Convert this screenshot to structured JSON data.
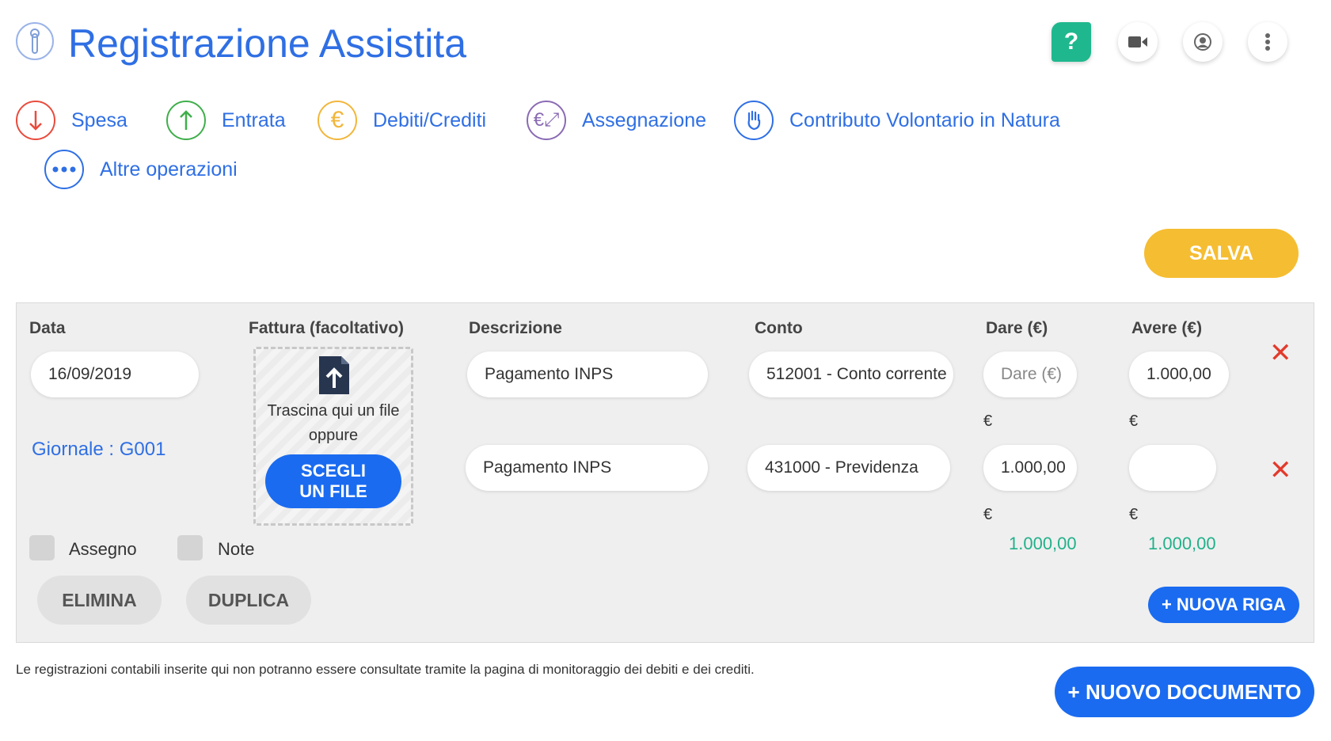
{
  "header": {
    "title": "Registrazione Assistita",
    "help_label": "?"
  },
  "operations": [
    {
      "label": "Spesa",
      "icon": "arrow-down-icon",
      "color": "#e94b3c"
    },
    {
      "label": "Entrata",
      "icon": "arrow-up-icon",
      "color": "#3fae4a"
    },
    {
      "label": "Debiti/Crediti",
      "icon": "euro-icon",
      "color": "#f2b63a"
    },
    {
      "label": "Assegnazione",
      "icon": "euro-exchange-icon",
      "color": "#8a6bb3"
    },
    {
      "label": "Contributo Volontario in Natura",
      "icon": "hand-icon",
      "color": "#2f6fe4"
    },
    {
      "label": "Altre operazioni",
      "icon": "more-horizontal-icon",
      "color": "#2f6fe4"
    }
  ],
  "save_label": "SALVA",
  "form": {
    "headers": {
      "data": "Data",
      "fattura": "Fattura (facoltativo)",
      "descrizione": "Descrizione",
      "conto": "Conto",
      "dare": "Dare (€)",
      "avere": "Avere (€)"
    },
    "date_value": "16/09/2019",
    "giornale_link": "Giornale : G001",
    "dropzone": {
      "line1": "Trascina qui un file",
      "line2": "oppure",
      "button_line1": "SCEGLI",
      "button_line2": "UN FILE"
    },
    "dare_placeholder": "Dare (€)",
    "rows": [
      {
        "descrizione": "Pagamento INPS",
        "conto": "512001 - Conto corrente",
        "dare": "",
        "avere": "1.000,00"
      },
      {
        "descrizione": "Pagamento INPS",
        "conto": "431000 - Previdenza",
        "dare": "1.000,00",
        "avere": ""
      }
    ],
    "currency_symbol": "€",
    "totals": {
      "dare": "1.000,00",
      "avere": "1.000,00"
    },
    "checkboxes": {
      "assegno": "Assegno",
      "note": "Note"
    },
    "buttons": {
      "elimina": "ELIMINA",
      "duplica": "DUPLICA",
      "nuova_riga": "+ NUOVA RIGA"
    }
  },
  "footnote": "Le registrazioni contabili inserite qui non potranno essere consultate tramite la pagina di monitoraggio dei debiti e dei crediti.",
  "new_document_label": "+ NUOVO DOCUMENTO"
}
